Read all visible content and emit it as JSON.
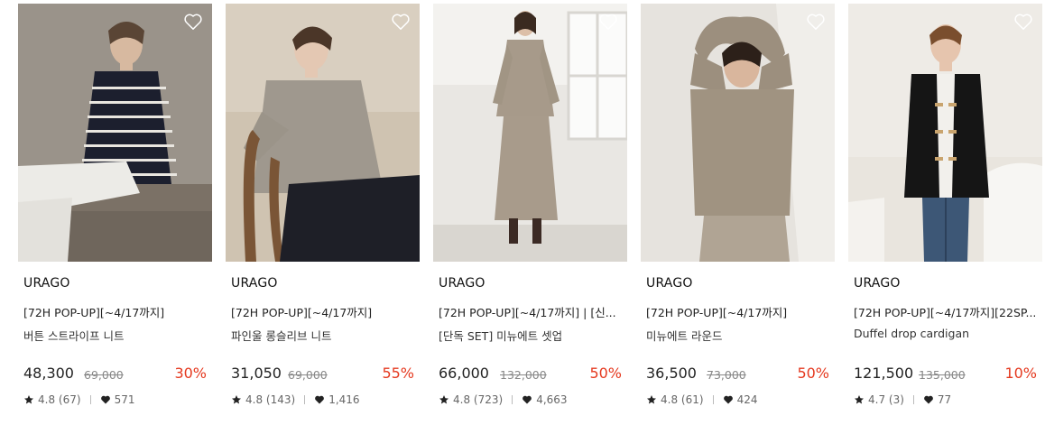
{
  "products": [
    {
      "brand": "URAGO",
      "name_line1": "[72H POP-UP][~4/17까지]",
      "name_line2": "버튼 스트라이프 니트",
      "price": "48,300",
      "original_price": "69,000",
      "discount": "30%",
      "rating": "4.8",
      "reviews": "(67)",
      "likes": "571",
      "image_desc": "model-in-striped-knit"
    },
    {
      "brand": "URAGO",
      "name_line1": "[72H POP-UP][~4/17까지]",
      "name_line2": "파인울 롱슬리브 니트",
      "price": "31,050",
      "original_price": "69,000",
      "discount": "55%",
      "rating": "4.8",
      "reviews": "(143)",
      "likes": "1,416",
      "image_desc": "model-in-grey-knit-on-chair"
    },
    {
      "brand": "URAGO",
      "name_line1": "[72H POP-UP][~4/17까지] | [신...",
      "name_line2": "[단독 SET] 미뉴에트 셋업",
      "price": "66,000",
      "original_price": "132,000",
      "discount": "50%",
      "rating": "4.8",
      "reviews": "(723)",
      "likes": "4,663",
      "image_desc": "model-in-knit-setup"
    },
    {
      "brand": "URAGO",
      "name_line1": "[72H POP-UP][~4/17까지]",
      "name_line2": "미뉴에트 라운드",
      "price": "36,500",
      "original_price": "73,000",
      "discount": "50%",
      "rating": "4.8",
      "reviews": "(61)",
      "likes": "424",
      "image_desc": "model-arms-raised-beige-knit"
    },
    {
      "brand": "URAGO",
      "name_line1": "[72H POP-UP][~4/17까지][22SP...",
      "name_line2": "Duffel drop cardigan",
      "price": "121,500",
      "original_price": "135,000",
      "discount": "10%",
      "rating": "4.7",
      "reviews": "(3)",
      "likes": "77",
      "image_desc": "model-in-black-duffel-cardigan"
    }
  ],
  "colors": {
    "discount": "#e5391f",
    "text": "#222222",
    "muted": "#888888"
  },
  "icons": [
    "heart-outline-icon",
    "star-icon",
    "heart-filled-icon"
  ]
}
